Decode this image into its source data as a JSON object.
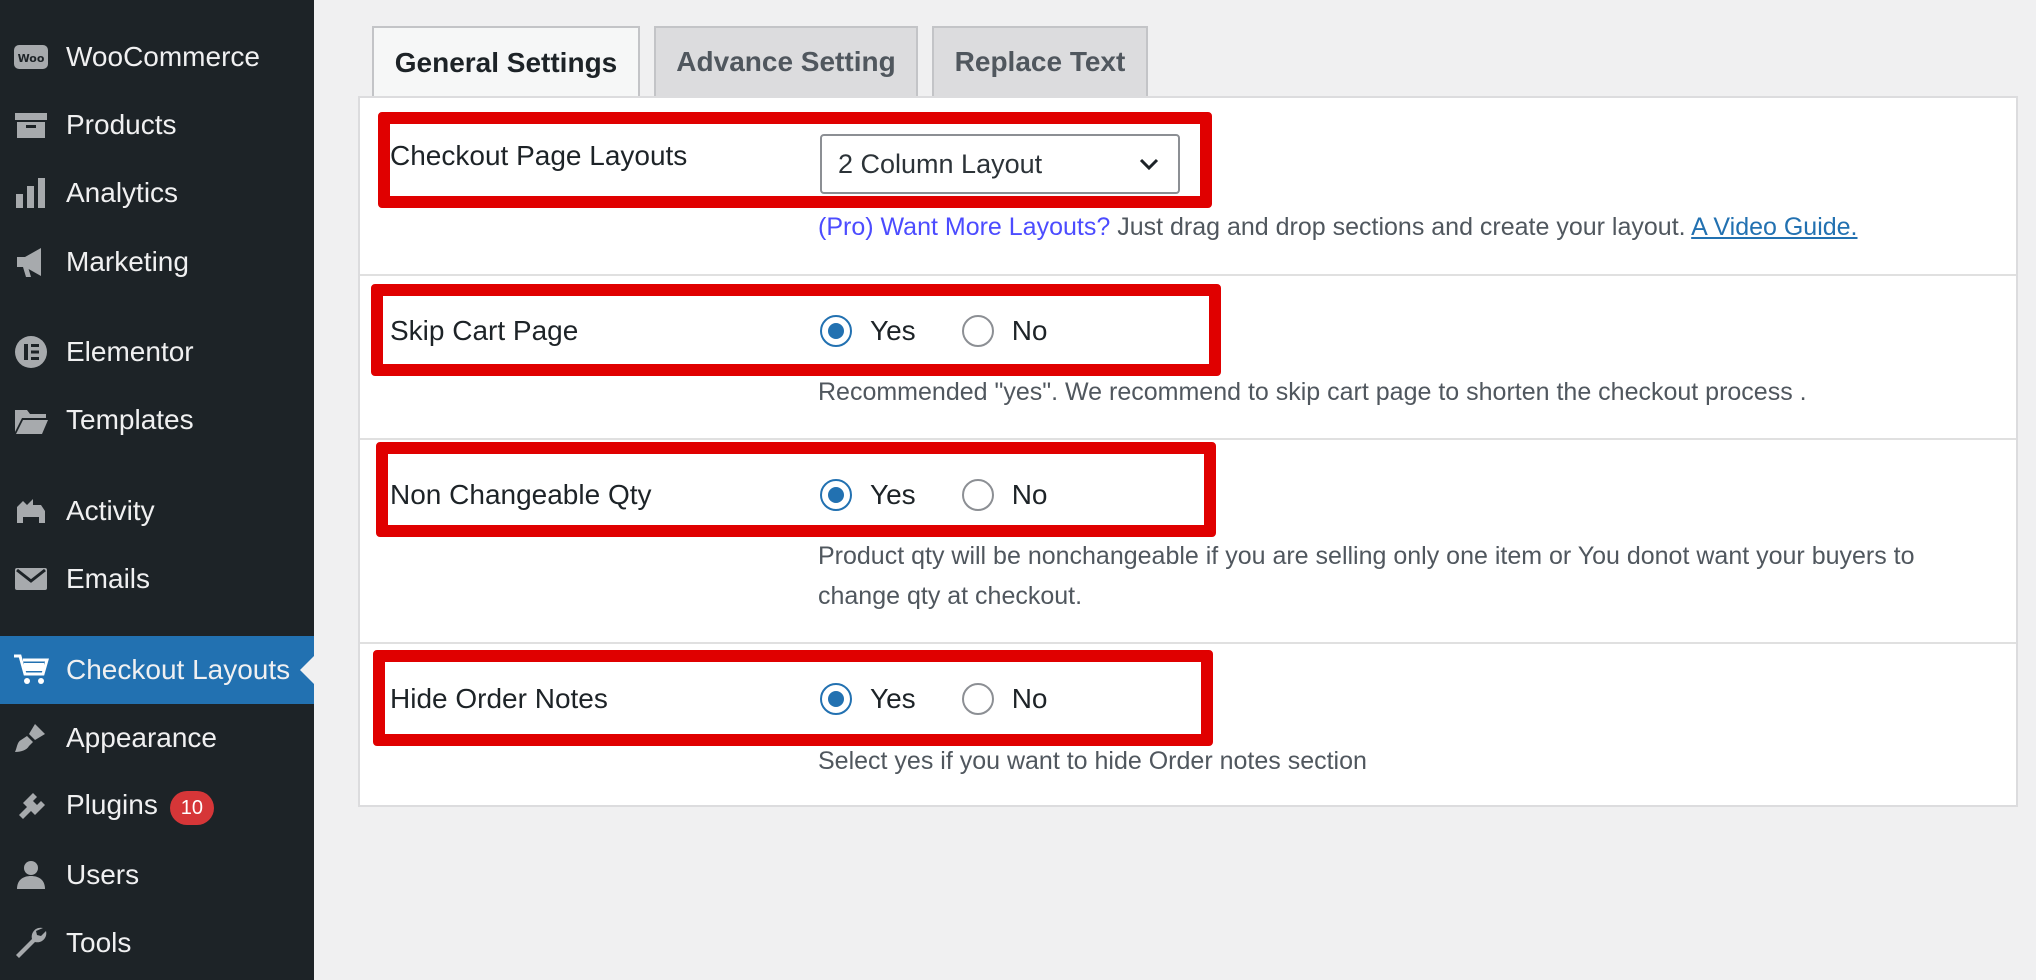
{
  "sidebar": {
    "items": [
      {
        "label": "WooCommerce",
        "icon": "woo-icon"
      },
      {
        "label": "Products",
        "icon": "archive-icon"
      },
      {
        "label": "Analytics",
        "icon": "bar-chart-icon"
      },
      {
        "label": "Marketing",
        "icon": "megaphone-icon"
      },
      {
        "label": "Elementor",
        "icon": "elementor-icon"
      },
      {
        "label": "Templates",
        "icon": "folder-icon"
      },
      {
        "label": "Activity",
        "icon": "activity-icon"
      },
      {
        "label": "Emails",
        "icon": "envelope-icon"
      },
      {
        "label": "Checkout Layouts",
        "icon": "cart-icon",
        "active": true
      },
      {
        "label": "Appearance",
        "icon": "brush-icon"
      },
      {
        "label": "Plugins",
        "icon": "plug-icon",
        "badge": "10"
      },
      {
        "label": "Users",
        "icon": "user-icon"
      },
      {
        "label": "Tools",
        "icon": "wrench-icon"
      }
    ]
  },
  "tabs": [
    {
      "label": "General Settings",
      "active": true
    },
    {
      "label": "Advance Setting"
    },
    {
      "label": "Replace Text"
    }
  ],
  "settings": {
    "layouts": {
      "label": "Checkout Page Layouts",
      "selected": "2 Column Layout",
      "pro_text": "(Pro) Want More Layouts?",
      "desc_text": " Just drag and drop sections and create your layout. ",
      "guide_link": "A Video Guide."
    },
    "skip_cart": {
      "label": "Skip Cart Page",
      "yes": "Yes",
      "no": "No",
      "desc": "Recommended \"yes\". We recommend to skip cart page to shorten the checkout process ."
    },
    "non_changeable_qty": {
      "label": "Non Changeable Qty",
      "yes": "Yes",
      "no": "No",
      "desc": "Product qty will be nonchangeable if you are selling only one item or You donot want your buyers to change qty at checkout."
    },
    "hide_order_notes": {
      "label": "Hide Order Notes",
      "yes": "Yes",
      "no": "No",
      "desc": "Select yes if you want to hide Order notes section"
    }
  },
  "colors": {
    "sidebar_bg": "#1d2327",
    "active_menu": "#2271b1",
    "highlight_box": "#e00000",
    "badge": "#d63638"
  }
}
